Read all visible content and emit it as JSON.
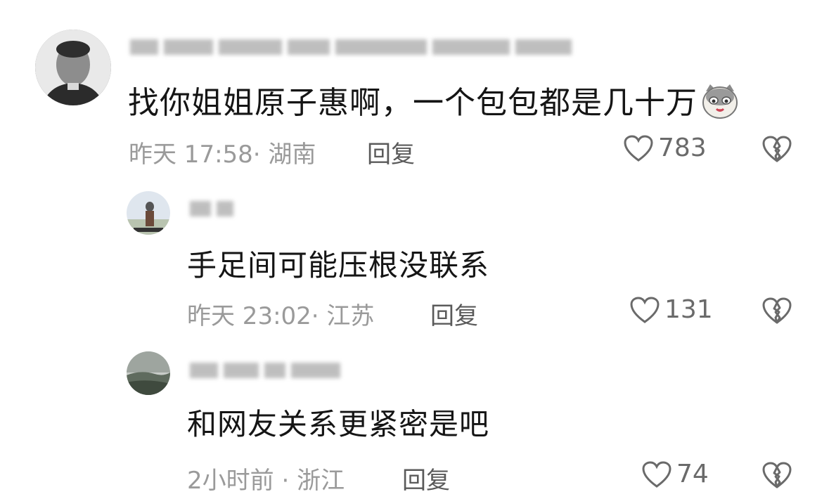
{
  "comments": [
    {
      "avatar": "portrait-avatar",
      "text": "找你姐姐原子惠啊，一个包包都是几十万",
      "emoji": "cat-face-emoji",
      "time": "昨天 17:58",
      "location": "湖南",
      "reply_label": "回复",
      "likes": "783"
    },
    {
      "avatar": "statue-avatar",
      "text": "手足间可能压根没联系",
      "time": "昨天 23:02",
      "location": "江苏",
      "reply_label": "回复",
      "likes": "131"
    },
    {
      "avatar": "landscape-avatar",
      "text": "和网友关系更紧密是吧",
      "time": "2小时前",
      "location": "浙江",
      "reply_label": "回复",
      "likes": "74"
    }
  ],
  "colors": {
    "text": "#151515",
    "meta": "#9a9a9a",
    "icon": "#6a6a6a"
  }
}
